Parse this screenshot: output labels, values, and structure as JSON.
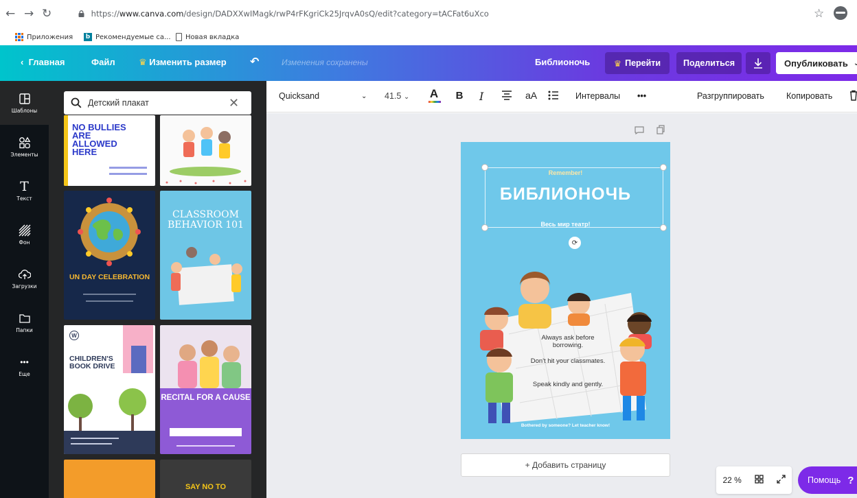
{
  "browser": {
    "url_prefix": "https://",
    "url_domain": "www.canva.com",
    "url_path": "/design/DADXXwIMagk/rwP4rFKgriCk25JrqvA0sQ/edit?category=tACFat6uXco",
    "bookmarks": [
      {
        "label": "Приложения"
      },
      {
        "label": "Рекомендуемые са..."
      },
      {
        "label": "Новая вкладка"
      }
    ]
  },
  "topbar": {
    "home": "Главная",
    "file": "Файл",
    "resize": "Изменить размер",
    "saved_status": "Изменения сохранены",
    "doc_title": "Библионочь",
    "upgrade": "Перейти",
    "share": "Поделиться",
    "publish": "Опубликовать"
  },
  "rail": {
    "items": [
      {
        "label": "Шаблоны",
        "icon": "templates-icon"
      },
      {
        "label": "Элементы",
        "icon": "elements-icon"
      },
      {
        "label": "Текст",
        "icon": "text-icon"
      },
      {
        "label": "Фон",
        "icon": "background-icon"
      },
      {
        "label": "Загрузки",
        "icon": "uploads-icon"
      },
      {
        "label": "Папки",
        "icon": "folder-icon"
      },
      {
        "label": "Еще",
        "icon": "more-icon"
      }
    ]
  },
  "panel": {
    "search_value": "Детский плакат",
    "templates": [
      {
        "title": "NO BULLIES ARE ALLOWED HERE"
      },
      {
        "title": ""
      },
      {
        "title": "UN DAY CELEBRATION"
      },
      {
        "title": "CLASSROOM BEHAVIOR 101"
      },
      {
        "title": "CHILDREN'S BOOK DRIVE"
      },
      {
        "title": "RECITAL FOR A CAUSE"
      },
      {
        "title": ""
      },
      {
        "title": "SAY NO TO"
      }
    ]
  },
  "toolbar": {
    "font": "Quicksand",
    "font_size": "41.5",
    "case": "aA",
    "spacing": "Интервалы",
    "more": "•••",
    "ungroup": "Разгруппировать",
    "copy": "Копировать"
  },
  "design": {
    "kicker": "Remember!",
    "title": "БИБЛИОНОЧЬ",
    "subtitle": "Весь мир театр!",
    "rules": [
      "Always ask before borrowing.",
      "Don't hit your classmates.",
      "Speak kindly and gently."
    ],
    "footer": "Bothered by someone? Let teacher know!",
    "background_color": "#6fc8ea"
  },
  "add_page": "+ Добавить страницу",
  "zoom": {
    "level": "22 %"
  },
  "help": {
    "label": "Помощь",
    "mark": "?"
  },
  "colors": {
    "brand": "#7d2ae8",
    "teal": "#00c4cc",
    "dark": "#0e1318"
  }
}
